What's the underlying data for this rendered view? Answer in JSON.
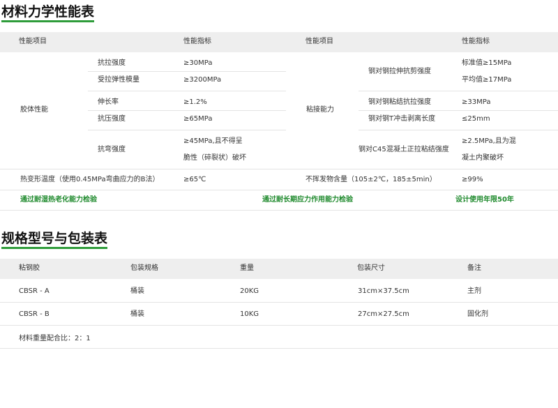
{
  "section1": {
    "title": "材料力学性能表",
    "headers": [
      "性能项目",
      "性能指标",
      "性能项目",
      "性能指标"
    ],
    "group_left": "胶体性能",
    "group_right": "粘接能力",
    "left_rows": [
      {
        "item": "抗拉强度",
        "value": "≥30MPa"
      },
      {
        "item": "受拉弹性模量",
        "value": "≥3200MPa"
      },
      {
        "item": "伸长率",
        "value": "≥1.2%"
      },
      {
        "item": "抗压强度",
        "value": "≥65MPa"
      },
      {
        "item": "抗弯强度",
        "value_line1": "≥45MPa,且不得呈",
        "value_line2": "脆性（碎裂状）破坏"
      }
    ],
    "right_rows": [
      {
        "item": "钢对钢拉伸抗剪强度",
        "value_line1": "标准值≥15MPa",
        "value_line2": "平均值≥17MPa"
      },
      {
        "item": "钢对钢粘结抗拉强度",
        "value": "≥33MPa"
      },
      {
        "item": "钢对钢T冲击剥离长度",
        "value": "≤25mm"
      },
      {
        "item": "钢对C45混凝土正拉粘结强度",
        "value_line1": "≥2.5MPa,且为混",
        "value_line2": "凝土内聚破坏"
      }
    ],
    "bottom_row": {
      "item_left": "热变形温度（使用0.45MPa弯曲应力的B法）",
      "value_left": "≥65℃",
      "item_right": "不挥发物含量（105±2℃，185±5min）",
      "value_right": "≥99%"
    },
    "tests": [
      "通过耐湿热老化能力检验",
      "通过耐长期应力作用能力检验",
      "设计使用年限50年"
    ]
  },
  "section2": {
    "title": "规格型号与包装表",
    "headers": [
      "粘钢胶",
      "包装规格",
      "重量",
      "包装尺寸",
      "备注"
    ],
    "rows": [
      [
        "CBSR - A",
        "桶装",
        "20KG",
        "31cm×37.5cm",
        "主剂"
      ],
      [
        "CBSR - B",
        "桶装",
        "10KG",
        "27cm×27.5cm",
        "固化剂"
      ]
    ],
    "note": "材料重量配合比：2：1"
  }
}
